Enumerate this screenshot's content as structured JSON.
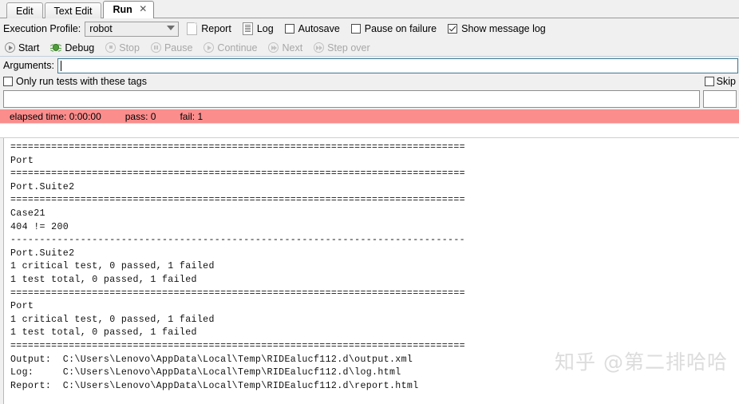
{
  "tabs": [
    {
      "label": "Edit",
      "active": false
    },
    {
      "label": "Text Edit",
      "active": false
    },
    {
      "label": "Run",
      "active": true,
      "close_icon": "close-icon"
    }
  ],
  "toolbar": {
    "execution_profile_label": "Execution Profile:",
    "profile_value": "robot",
    "profile_options": [
      "robot"
    ],
    "report_label": "Report",
    "report_icon": "document-icon",
    "log_label": "Log",
    "log_icon": "document-lines-icon",
    "autosave_label": "Autosave",
    "autosave_checked": false,
    "pause_on_failure_label": "Pause on failure",
    "pause_on_failure_checked": false,
    "show_message_log_label": "Show message log",
    "show_message_log_checked": true
  },
  "runcontrols": [
    {
      "label": "Start",
      "icon": "play-circle-icon",
      "enabled": true
    },
    {
      "label": "Debug",
      "icon": "bug-icon",
      "enabled": true
    },
    {
      "label": "Stop",
      "icon": "stop-circle-icon",
      "enabled": false
    },
    {
      "label": "Pause",
      "icon": "pause-circle-icon",
      "enabled": false
    },
    {
      "label": "Continue",
      "icon": "play-circle-icon",
      "enabled": false
    },
    {
      "label": "Next",
      "icon": "next-circle-icon",
      "enabled": false
    },
    {
      "label": "Step over",
      "icon": "step-over-circle-icon",
      "enabled": false
    }
  ],
  "arguments": {
    "label": "Arguments:",
    "value": "",
    "placeholder": ""
  },
  "tags": {
    "only_run_label": "Only run tests with these tags",
    "only_run_checked": false,
    "skip_label": "Skip",
    "skip_checked": false,
    "include_value": "",
    "exclude_value": ""
  },
  "status": {
    "elapsed": "elapsed time: 0:00:00",
    "pass": "pass: 0",
    "fail": "fail: 1",
    "background_color": "#fb8d8d",
    "fail_state": true
  },
  "output": {
    "text": "==============================================================================\nPort\n==============================================================================\nPort.Suite2\n==============================================================================\nCase21\n404 != 200\n------------------------------------------------------------------------------\nPort.Suite2\n1 critical test, 0 passed, 1 failed\n1 test total, 0 passed, 1 failed\n==============================================================================\nPort\n1 critical test, 0 passed, 1 failed\n1 test total, 0 passed, 1 failed\n==============================================================================\nOutput:  C:\\Users\\Lenovo\\AppData\\Local\\Temp\\RIDEalucf112.d\\output.xml\nLog:     C:\\Users\\Lenovo\\AppData\\Local\\Temp\\RIDEalucf112.d\\log.html\nReport:  C:\\Users\\Lenovo\\AppData\\Local\\Temp\\RIDEalucf112.d\\report.html"
  },
  "watermark": {
    "text": "知乎 @第二排哈哈"
  }
}
